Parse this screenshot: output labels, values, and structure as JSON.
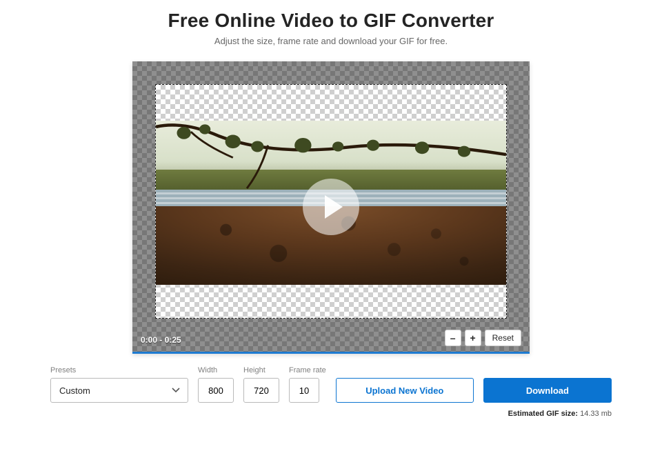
{
  "header": {
    "title": "Free Online Video to GIF Converter",
    "subtitle": "Adjust the size, frame rate and download your GIF for free."
  },
  "player": {
    "time_range": "0:00 - 0:25",
    "zoom": {
      "out": "–",
      "in": "+",
      "reset": "Reset"
    }
  },
  "form": {
    "presets": {
      "label": "Presets",
      "value": "Custom"
    },
    "width": {
      "label": "Width",
      "value": "800"
    },
    "height": {
      "label": "Height",
      "value": "720"
    },
    "fps": {
      "label": "Frame rate",
      "value": "10"
    }
  },
  "actions": {
    "upload": "Upload New Video",
    "download": "Download"
  },
  "estimate": {
    "label": "Estimated GIF size:",
    "value": "14.33 mb"
  }
}
